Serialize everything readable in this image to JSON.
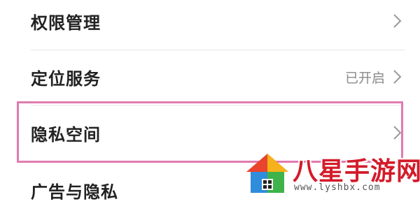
{
  "settings": {
    "items": [
      {
        "label": "权限管理",
        "value": ""
      },
      {
        "label": "定位服务",
        "value": "已开启"
      },
      {
        "label": "隐私空间",
        "value": ""
      },
      {
        "label": "广告与隐私",
        "value": ""
      }
    ],
    "highlight_color": "#e07bb0"
  },
  "watermark": {
    "title": "八星手游网",
    "url": "www.lyshbx.com",
    "logo_icon": "house-logo-icon"
  }
}
